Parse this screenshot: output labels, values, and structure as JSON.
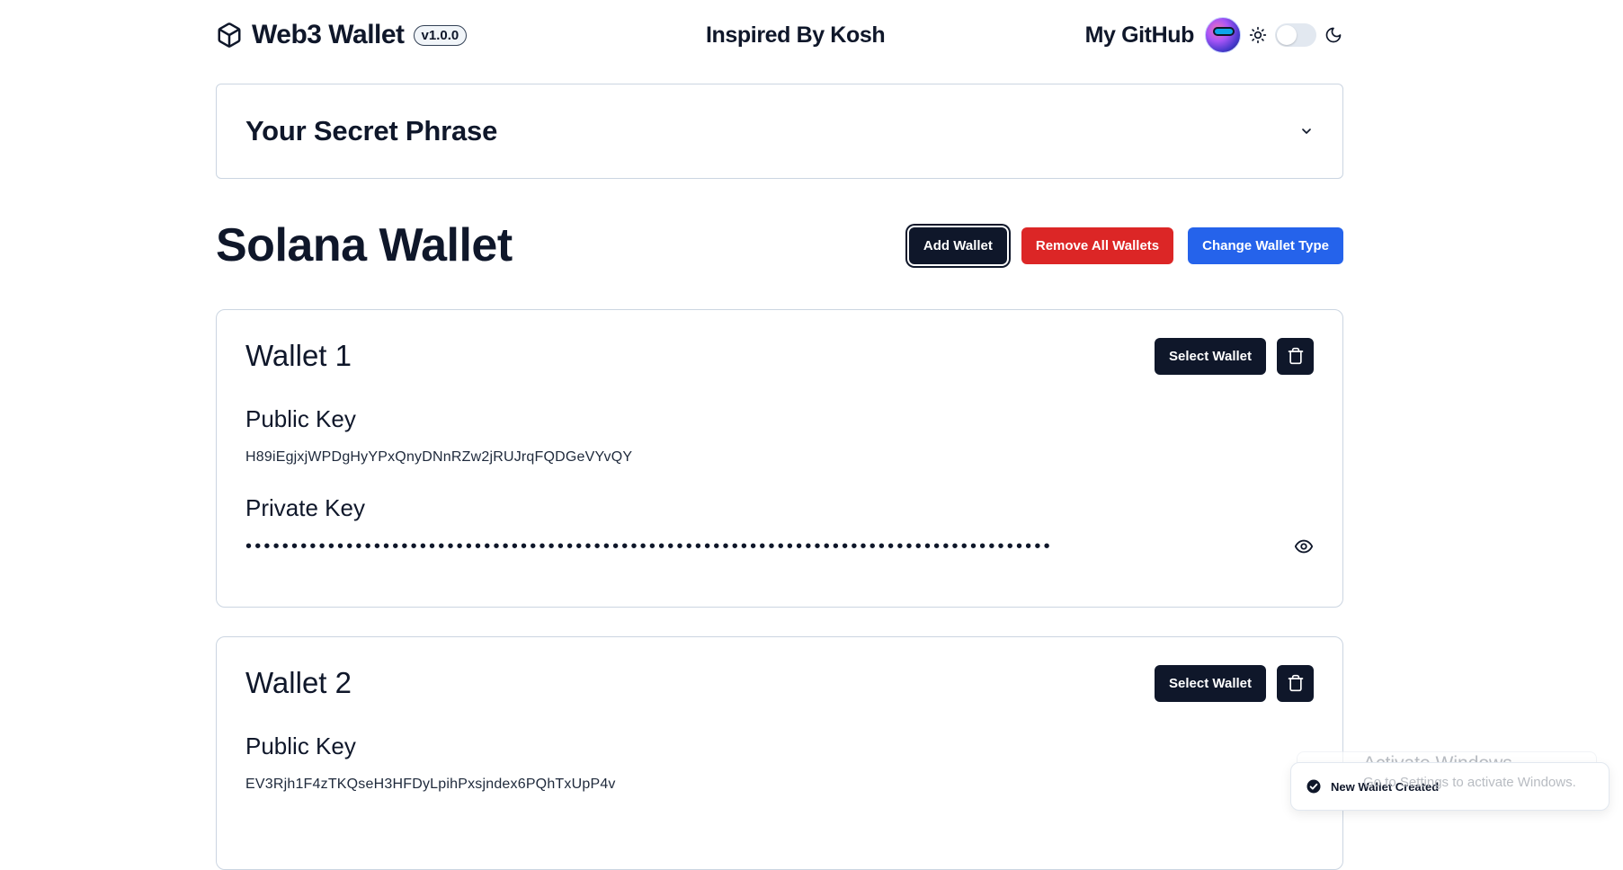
{
  "header": {
    "brand_title": "Web3 Wallet",
    "version": "v1.0.0",
    "tagline": "Inspired By Kosh",
    "github_label": "My GitHub",
    "brand_icon": "cube-icon",
    "theme_light_icon": "sun-icon",
    "theme_dark_icon": "moon-icon",
    "theme_toggle_on": false
  },
  "secret_phrase": {
    "title": "Your Secret Phrase",
    "expanded": false,
    "icon": "chevron-down-icon"
  },
  "section": {
    "title": "Solana Wallet",
    "add_wallet": "Add Wallet",
    "remove_all": "Remove All Wallets",
    "change_type": "Change Wallet Type"
  },
  "wallets": [
    {
      "name": "Wallet 1",
      "select_label": "Select Wallet",
      "public_key_label": "Public Key",
      "public_key": "H89iEgjxjWPDgHyYPxQnyDNnRZw2jRUJrqFQDGeVYvQY",
      "private_key_label": "Private Key",
      "private_key_masked": "••••••••••••••••••••••••••••••••••••••••••••••••••••••••••••••••••••••••••••••••••••••••"
    },
    {
      "name": "Wallet 2",
      "select_label": "Select Wallet",
      "public_key_label": "Public Key",
      "public_key": "EV3Rjh1F4zTKQseH3HFDyLpihPxsjndex6PQhTxUpP4v"
    }
  ],
  "toast": {
    "message": "New Wallet Created",
    "icon": "check-circle-icon"
  },
  "watermark": {
    "title": "Activate Windows",
    "subtitle": "Go to Settings to activate Windows."
  },
  "colors": {
    "dark": "#0f172a",
    "danger": "#dc2626",
    "primary": "#2563eb",
    "border": "#cbd5e1"
  }
}
